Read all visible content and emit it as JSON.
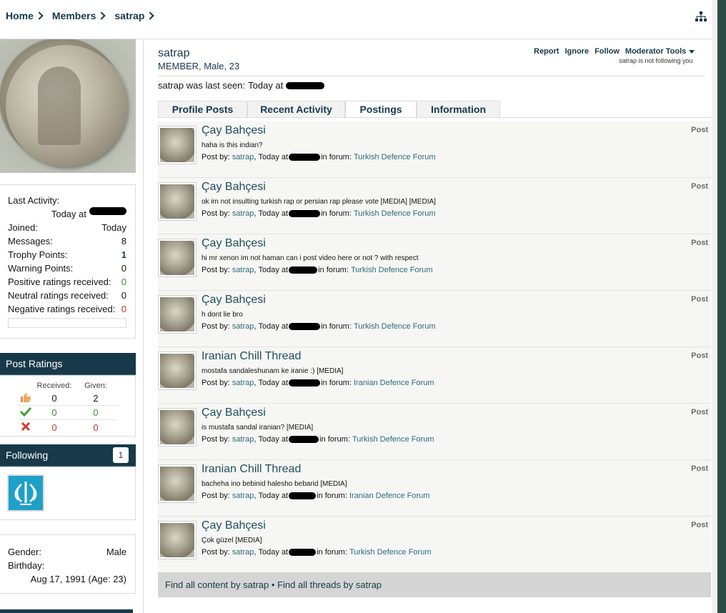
{
  "breadcrumb": [
    "Home",
    "Members",
    "satrap"
  ],
  "profile": {
    "name": "satrap",
    "title": "MEMBER, Male, 23",
    "last_seen_label": "satrap was last seen:",
    "last_seen_value": "Today at",
    "actions": [
      "Report",
      "Ignore",
      "Follow"
    ],
    "moderator_tools": "Moderator Tools",
    "not_following": "satrap is not following you"
  },
  "stats": {
    "last_activity_label": "Last Activity:",
    "last_activity_value": "Today at",
    "rows": [
      {
        "label": "Joined:",
        "value": "Today"
      },
      {
        "label": "Messages:",
        "value": "8"
      },
      {
        "label": "Trophy Points:",
        "value": "1"
      },
      {
        "label": "Warning Points:",
        "value": "0"
      },
      {
        "label": "Positive ratings received:",
        "value": "0"
      },
      {
        "label": "Neutral ratings received:",
        "value": "0"
      },
      {
        "label": "Negative ratings received:",
        "value": "0"
      }
    ]
  },
  "post_ratings": {
    "title": "Post Ratings",
    "received_label": "Received:",
    "given_label": "Given:",
    "rows": [
      {
        "icon": "thumbs-up-icon",
        "received": "0",
        "given": "2"
      },
      {
        "icon": "check-icon",
        "received": "0",
        "given": "0"
      },
      {
        "icon": "cross-icon",
        "received": "0",
        "given": "0"
      }
    ]
  },
  "following": {
    "title": "Following",
    "count": "1"
  },
  "about": {
    "gender_label": "Gender:",
    "gender_value": "Male",
    "birthday_label": "Birthday:",
    "birthday_value": "Aug 17, 1991 (Age: 23)"
  },
  "tabs": [
    "Profile Posts",
    "Recent Activity",
    "Postings",
    "Information"
  ],
  "active_tab": "Postings",
  "results": [
    {
      "title": "Çay Bahçesi",
      "snippet": "haha is this indian?",
      "forum": "Turkish Defence Forum",
      "type": "Post"
    },
    {
      "title": "Çay Bahçesi",
      "snippet": "ok im not insulting turkish rap or persian rap please vote [MEDIA] [MEDIA]",
      "forum": "Turkish Defence Forum",
      "type": "Post"
    },
    {
      "title": "Çay Bahçesi",
      "snippet": "hi mr xenon im not haman can i post video here or not ? with respect",
      "forum": "Turkish Defence Forum",
      "type": "Post"
    },
    {
      "title": "Çay Bahçesi",
      "snippet": "h dont lie bro",
      "forum": "Turkish Defence Forum",
      "type": "Post"
    },
    {
      "title": "Iranian Chill Thread",
      "snippet": "mostafa sandaleshunam ke iranie :) [MEDIA]",
      "forum": "Iranian Defence Forum",
      "type": "Post"
    },
    {
      "title": "Çay Bahçesi",
      "snippet": "is mustafa sandal iranian? [MEDIA]",
      "forum": "Turkish Defence Forum",
      "type": "Post"
    },
    {
      "title": "Iranian Chill Thread",
      "snippet": "bacheha ino bebinid halesho bebarid [MEDIA]",
      "forum": "Iranian Defence Forum",
      "type": "Post"
    },
    {
      "title": "Çay Bahçesi",
      "snippet": "Çok güzel [MEDIA]",
      "forum": "Turkish Defence Forum",
      "type": "Post"
    }
  ],
  "result_meta": {
    "post_by": "Post by:",
    "author": "satrap",
    "today_at": "Today at",
    "in_forum": "in forum:"
  },
  "find_bar": {
    "all_content": "Find all content by satrap",
    "separator": "•",
    "all_threads": "Find all threads by satrap"
  },
  "colors": {
    "header_bg": "#17394a",
    "link": "#17394a",
    "positive": "#3f8f2f",
    "negative": "#c0392b"
  }
}
